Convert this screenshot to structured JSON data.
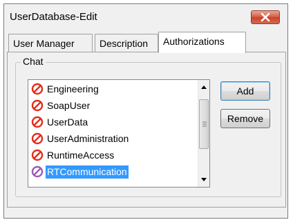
{
  "window": {
    "title": "UserDatabase-Edit"
  },
  "tabs": [
    {
      "label": "User Manager",
      "active": false
    },
    {
      "label": "Description",
      "active": false
    },
    {
      "label": "Authorizations",
      "active": true
    }
  ],
  "group": {
    "label": "Chat"
  },
  "list": {
    "items": [
      {
        "label": "Engineering",
        "icon": "prohibited-icon",
        "selected": false
      },
      {
        "label": "SoapUser",
        "icon": "prohibited-icon",
        "selected": false
      },
      {
        "label": "UserData",
        "icon": "prohibited-icon",
        "selected": false
      },
      {
        "label": "UserAdministration",
        "icon": "prohibited-icon",
        "selected": false
      },
      {
        "label": "RuntimeAccess",
        "icon": "prohibited-icon",
        "selected": false
      },
      {
        "label": "RTCommunication",
        "icon": "prohibited-icon",
        "selected": true
      }
    ]
  },
  "buttons": {
    "add": "Add",
    "remove": "Remove"
  },
  "colors": {
    "prohibited": "#e52a1a",
    "prohibited_selected": "#9b59b6",
    "selection": "#3399ff",
    "close": "#c7432b"
  }
}
